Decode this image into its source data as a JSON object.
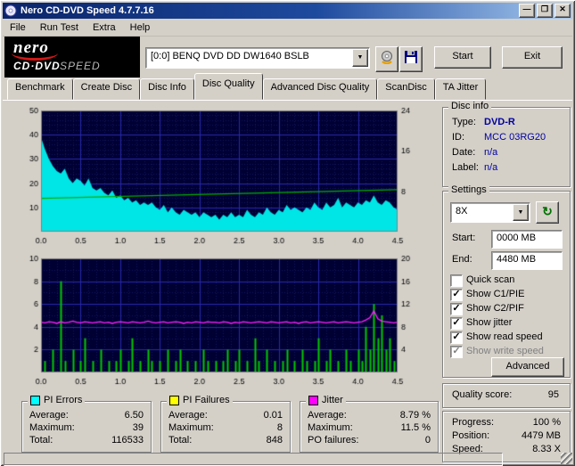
{
  "window": {
    "title": "Nero CD-DVD Speed 4.7.7.16"
  },
  "icons": {
    "minimize": "—",
    "maximize": "❐",
    "close": "✕",
    "dropdown": "▼",
    "refresh": "↻",
    "check": "✓"
  },
  "menu": {
    "items": [
      "File",
      "Run Test",
      "Extra",
      "Help"
    ]
  },
  "logo": {
    "line1": "nero",
    "line2": "CD·DVD",
    "line3": "SPEED"
  },
  "toolbar": {
    "drive": "[0:0]   BENQ   DVD DD DW1640 BSLB",
    "start": "Start",
    "exit": "Exit"
  },
  "tabs": {
    "items": [
      "Benchmark",
      "Create Disc",
      "Disc Info",
      "Disc Quality",
      "Advanced Disc Quality",
      "ScanDisc",
      "TA Jitter"
    ],
    "active": "Disc Quality"
  },
  "disc_info": {
    "title": "Disc info",
    "rows": [
      {
        "label": "Type:",
        "value": "DVD-R"
      },
      {
        "label": "ID:",
        "value": "MCC 03RG20"
      },
      {
        "label": "Date:",
        "value": "n/a"
      },
      {
        "label": "Label:",
        "value": "n/a"
      }
    ]
  },
  "settings": {
    "title": "Settings",
    "speed": "8X",
    "start_label": "Start:",
    "start_value": "0000 MB",
    "end_label": "End:",
    "end_value": "4480 MB",
    "checkboxes": [
      {
        "label": "Quick scan",
        "checked": false,
        "disabled": false
      },
      {
        "label": "Show C1/PIE",
        "checked": true,
        "disabled": false
      },
      {
        "label": "Show C2/PIF",
        "checked": true,
        "disabled": false
      },
      {
        "label": "Show jitter",
        "checked": true,
        "disabled": false
      },
      {
        "label": "Show read speed",
        "checked": true,
        "disabled": false
      },
      {
        "label": "Show write speed",
        "checked": true,
        "disabled": true
      }
    ],
    "advanced": "Advanced"
  },
  "quality": {
    "label": "Quality score:",
    "value": "95"
  },
  "progress": {
    "rows": [
      {
        "label": "Progress:",
        "value": "100 %"
      },
      {
        "label": "Position:",
        "value": "4479 MB"
      },
      {
        "label": "Speed:",
        "value": "8.33 X"
      }
    ]
  },
  "stats": [
    {
      "title": "PI Errors",
      "color": "#00ffff",
      "rows": [
        {
          "label": "Average:",
          "value": "6.50"
        },
        {
          "label": "Maximum:",
          "value": "39"
        },
        {
          "label": "Total:",
          "value": "116533"
        }
      ]
    },
    {
      "title": "PI Failures",
      "color": "#ffff00",
      "rows": [
        {
          "label": "Average:",
          "value": "0.01"
        },
        {
          "label": "Maximum:",
          "value": "8"
        },
        {
          "label": "Total:",
          "value": "848"
        }
      ]
    },
    {
      "title": "Jitter",
      "color": "#ff00ff",
      "rows": [
        {
          "label": "Average:",
          "value": "8.79 %"
        },
        {
          "label": "Maximum:",
          "value": "11.5 %"
        },
        {
          "label": "PO failures:",
          "value": "0"
        }
      ]
    }
  ],
  "chart_data": [
    {
      "type": "area",
      "title": "PI Errors vs position (GB) with read speed",
      "x_min": 0,
      "x_max": 4.5,
      "minor_x": 0.1,
      "minor_y": 2,
      "x_ticks": [
        "0.0",
        "0.5",
        "1.0",
        "1.5",
        "2.0",
        "2.5",
        "3.0",
        "3.5",
        "4.0",
        "4.5"
      ],
      "y_left": {
        "min": 0,
        "max": 50,
        "ticks": [
          10,
          20,
          30,
          40,
          50
        ]
      },
      "y_right": {
        "min": 0,
        "max": 24,
        "ticks": [
          8,
          16,
          24
        ]
      },
      "bg": "#000033",
      "grid_major": "#2828b0",
      "grid_minor": "#15155e",
      "series": [
        {
          "name": "PI Errors",
          "type": "area",
          "axis": "left",
          "color": "#00e5e5",
          "values": [
            39,
            34,
            30,
            27,
            25,
            24,
            26,
            22,
            20,
            22,
            21,
            19,
            22,
            18,
            17,
            18,
            16,
            15,
            17,
            14,
            15,
            13,
            14,
            12,
            13,
            11,
            12,
            11,
            12,
            10,
            9,
            11,
            8,
            10,
            8,
            7,
            9,
            8,
            7,
            8,
            6,
            8,
            7,
            6,
            7,
            5,
            7,
            6,
            8,
            6,
            7,
            6,
            9,
            7,
            6,
            8,
            7,
            10,
            8,
            7,
            9,
            8,
            11,
            9,
            10,
            9,
            8,
            10,
            9,
            12,
            10,
            9,
            12,
            10,
            11,
            14,
            10,
            12,
            11,
            10,
            12,
            11,
            13,
            12,
            15,
            12,
            11,
            13,
            12,
            10,
            9
          ]
        },
        {
          "name": "Read speed",
          "type": "line",
          "axis": "right",
          "color": "#00b000",
          "x": [
            0,
            4.5
          ],
          "values": [
            6.6,
            8.33
          ]
        }
      ]
    },
    {
      "type": "bar",
      "title": "PI Failures and Jitter vs position (GB)",
      "x_min": 0,
      "x_max": 4.5,
      "minor_x": 0.1,
      "minor_y": 1,
      "x_ticks": [
        "0.0",
        "0.5",
        "1.0",
        "1.5",
        "2.0",
        "2.5",
        "3.0",
        "3.5",
        "4.0",
        "4.5"
      ],
      "y_left": {
        "min": 0,
        "max": 10,
        "ticks": [
          2,
          4,
          6,
          8,
          10
        ]
      },
      "y_right": {
        "min": 0,
        "max": 20,
        "ticks": [
          4,
          8,
          12,
          16,
          20
        ]
      },
      "bg": "#000033",
      "grid_major": "#2828b0",
      "grid_minor": "#15155e",
      "series": [
        {
          "name": "PI Failures",
          "type": "bars",
          "axis": "left",
          "color": "#00c800",
          "values": [
            0,
            1,
            0,
            2,
            0,
            8,
            1,
            0,
            2,
            0,
            1,
            3,
            0,
            1,
            0,
            2,
            0,
            1,
            0,
            1,
            2,
            0,
            1,
            3,
            0,
            1,
            0,
            2,
            1,
            0,
            1,
            0,
            2,
            0,
            1,
            2,
            0,
            1,
            0,
            1,
            0,
            2,
            1,
            0,
            1,
            0,
            1,
            2,
            0,
            1,
            2,
            0,
            1,
            0,
            3,
            1,
            0,
            2,
            0,
            1,
            0,
            1,
            2,
            0,
            1,
            0,
            2,
            1,
            0,
            1,
            3,
            0,
            1,
            2,
            0,
            1,
            0,
            2,
            1,
            0,
            2,
            1,
            4,
            2,
            6,
            3,
            5,
            2,
            3,
            1,
            0
          ]
        },
        {
          "name": "Jitter",
          "type": "line",
          "axis": "right",
          "color": "#ff22ff",
          "values": [
            8.8,
            8.7,
            8.9,
            8.8,
            8.6,
            8.9,
            8.7,
            8.8,
            9.0,
            8.8,
            8.7,
            8.9,
            8.8,
            8.7,
            8.8,
            8.9,
            8.7,
            8.8,
            8.6,
            8.8,
            8.9,
            8.8,
            8.7,
            8.9,
            8.8,
            8.7,
            8.8,
            9.0,
            8.8,
            8.7,
            8.8,
            8.9,
            8.7,
            8.8,
            8.9,
            8.8,
            8.6,
            8.8,
            8.7,
            8.9,
            8.8,
            8.7,
            8.9,
            8.8,
            8.8,
            8.7,
            8.9,
            8.8,
            8.6,
            8.8,
            8.7,
            8.9,
            8.8,
            8.7,
            8.8,
            8.9,
            8.8,
            8.7,
            8.9,
            8.8,
            8.7,
            8.8,
            8.9,
            8.7,
            8.8,
            8.6,
            8.8,
            8.9,
            8.7,
            8.8,
            8.9,
            8.8,
            8.7,
            8.8,
            8.9,
            8.7,
            8.8,
            8.9,
            8.8,
            8.7,
            8.8,
            8.9,
            9.2,
            9.6,
            10.8,
            9.4,
            9.0,
            8.9,
            8.8,
            8.7,
            8.8
          ]
        }
      ]
    }
  ]
}
